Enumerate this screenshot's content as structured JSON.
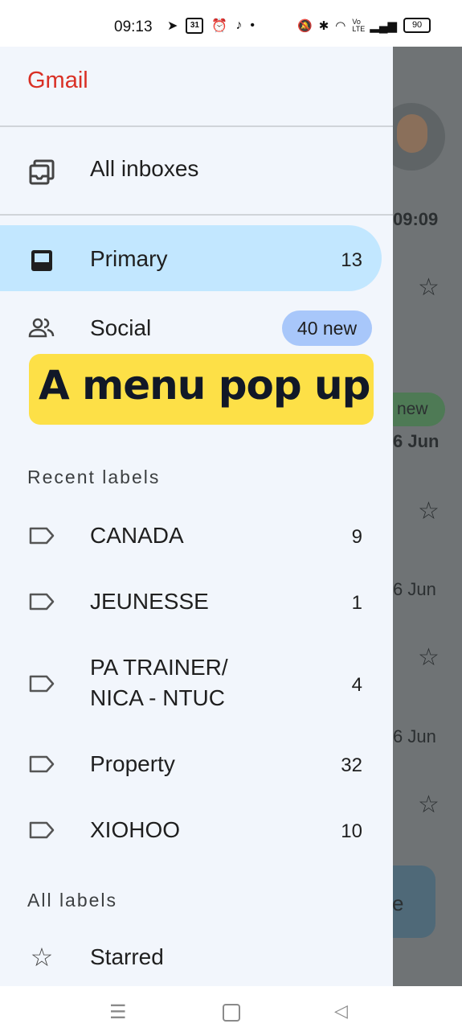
{
  "status_bar": {
    "time": "09:13",
    "calendar_date": "31",
    "battery": "90",
    "signal_text": "Vo LTE"
  },
  "background_list": {
    "time_top": "09:09",
    "new_label": "new",
    "date_1": "6 Jun",
    "date_2": "6 Jun",
    "date_3": "6 Jun",
    "compose_fragment": "e"
  },
  "drawer": {
    "brand": "Gmail",
    "all_inboxes": "All inboxes",
    "primary": {
      "label": "Primary",
      "count": "13"
    },
    "social": {
      "label": "Social",
      "badge": "40 new"
    },
    "banner": "A menu pop up",
    "recent_labels_heading": "Recent labels",
    "labels": [
      {
        "name": "CANADA",
        "count": "9"
      },
      {
        "name": "JEUNESSE",
        "count": "1"
      },
      {
        "name_line1": "PA TRAINER/",
        "name_line2": "NICA - NTUC",
        "count": "4"
      },
      {
        "name": "Property",
        "count": "32"
      },
      {
        "name": "XIOHOO",
        "count": "10"
      }
    ],
    "all_labels_heading": "All labels",
    "starred": "Starred"
  },
  "colors": {
    "brand_red": "#d93025",
    "primary_highlight": "#c2e7ff",
    "badge_blue": "#a8c7fa",
    "banner_yellow": "#fde047"
  }
}
